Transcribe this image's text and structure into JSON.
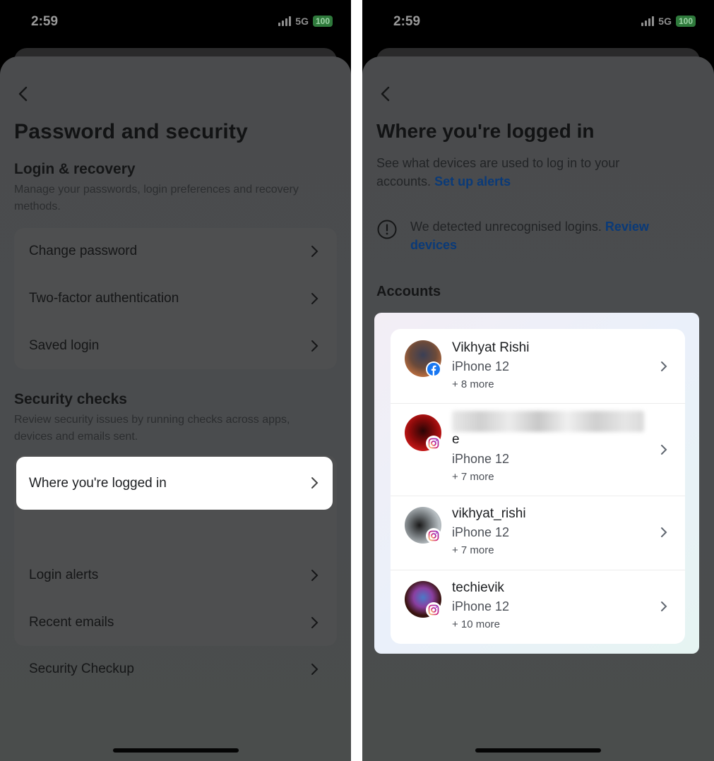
{
  "left_screen": {
    "status_bar": {
      "time": "2:59",
      "network": "5G",
      "battery": "100"
    },
    "page_title": "Password and security",
    "login_recovery": {
      "title": "Login & recovery",
      "description": "Manage your passwords, login preferences and recovery methods.",
      "items": [
        {
          "label": "Change password"
        },
        {
          "label": "Two-factor authentication"
        },
        {
          "label": "Saved login"
        }
      ]
    },
    "security_checks": {
      "title": "Security checks",
      "description": "Review security issues by running checks across apps, devices and emails sent.",
      "highlighted_item": {
        "label": "Where you're logged in"
      },
      "items": [
        {
          "label": "Login alerts"
        },
        {
          "label": "Recent emails"
        },
        {
          "label": "Security Checkup"
        }
      ]
    }
  },
  "right_screen": {
    "status_bar": {
      "time": "2:59",
      "network": "5G",
      "battery": "100"
    },
    "page_title": "Where you're logged in",
    "description": "See what devices are used to log in to your accounts.",
    "setup_alerts_link": "Set up alerts",
    "alert": {
      "text": "We detected unrecognised logins.",
      "link": "Review devices"
    },
    "accounts_title": "Accounts",
    "accounts": [
      {
        "name": "Vikhyat Rishi",
        "platform": "facebook",
        "device": "iPhone 12",
        "more": "+ 8 more"
      },
      {
        "name_suffix": "e",
        "name_blurred": true,
        "platform": "instagram",
        "device": "iPhone 12",
        "more": "+ 7 more"
      },
      {
        "name": "vikhyat_rishi",
        "platform": "instagram",
        "device": "iPhone 12",
        "more": "+ 7 more"
      },
      {
        "name": "techievik",
        "platform": "instagram",
        "device": "iPhone 12",
        "more": "+ 10 more"
      }
    ]
  },
  "colors": {
    "link_blue": "#0a3a78",
    "facebook_blue": "#1877f2",
    "battery_green": "#2f7a3c",
    "overlay_gray": "#4a4c4e"
  }
}
